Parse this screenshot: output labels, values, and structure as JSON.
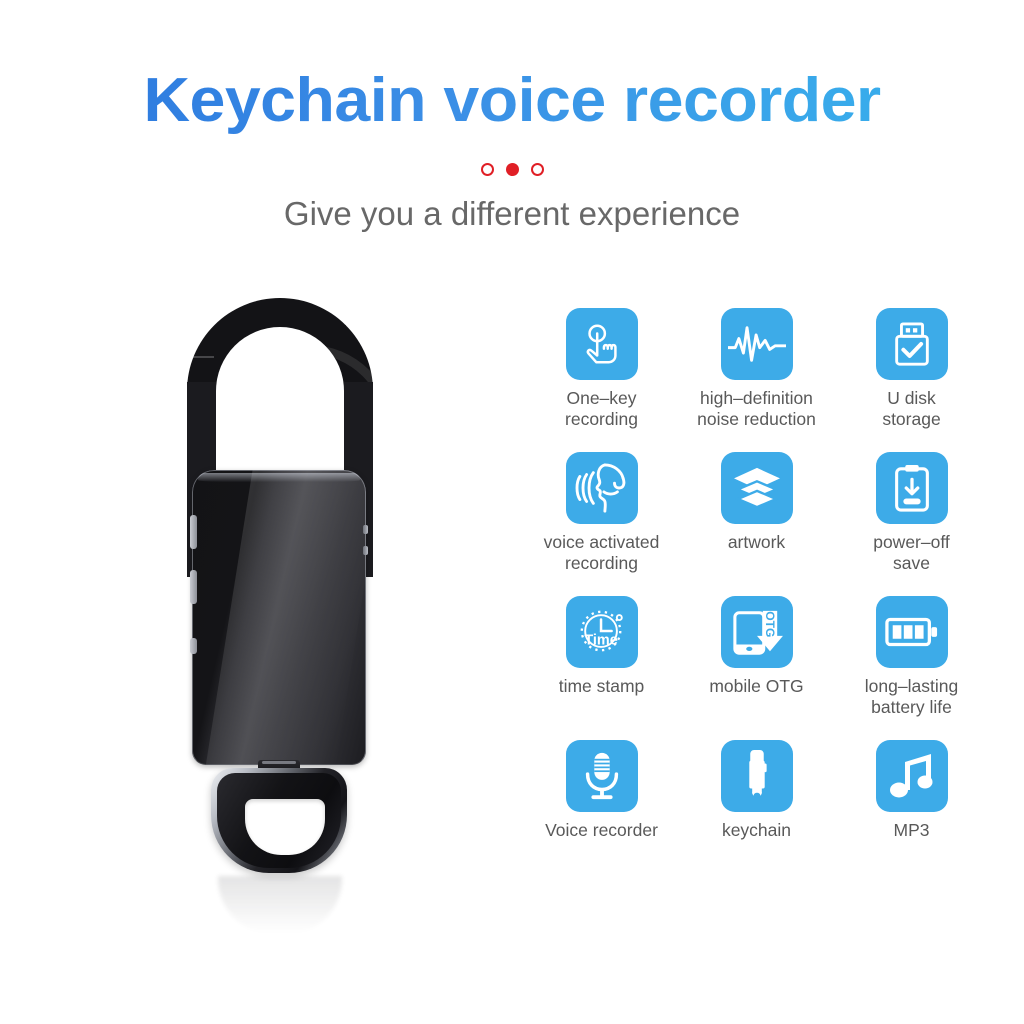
{
  "page": {
    "background_color": "#ffffff",
    "title": "Keychain voice recorder",
    "subtitle": "Give you a different experience",
    "title_gradient_from": "#2f7de0",
    "title_gradient_to": "#36b4ef",
    "subtitle_color": "#686868",
    "accent_tile_color": "#3dabe8",
    "dot_color": "#e01f26",
    "label_color": "#595959"
  },
  "dots": [
    {
      "name": "dot-1",
      "style": "hollow"
    },
    {
      "name": "dot-2",
      "style": "filled"
    },
    {
      "name": "dot-3",
      "style": "hollow"
    }
  ],
  "product": {
    "name": "keychain-voice-recorder",
    "body_color": "#1c1c20",
    "hook_color": "#131316",
    "ring_metal_color": "#c9ccd2"
  },
  "features": [
    [
      {
        "icon": "one-key-tap-icon",
        "label": "One–key\nrecording"
      },
      {
        "icon": "waveform-icon",
        "label": "high–definition\nnoise reduction"
      },
      {
        "icon": "usb-drive-check-icon",
        "label": "U disk\nstorage"
      }
    ],
    [
      {
        "icon": "voice-activated-icon",
        "label": "voice activated\nrecording"
      },
      {
        "icon": "layers-icon",
        "label": "artwork"
      },
      {
        "icon": "power-off-save-icon",
        "label": "power–off\nsave"
      }
    ],
    [
      {
        "icon": "time-stamp-clock-icon",
        "label": "time stamp",
        "icon_text": "Time"
      },
      {
        "icon": "mobile-otg-icon",
        "label": "mobile OTG",
        "icon_text": "OTG"
      },
      {
        "icon": "battery-full-icon",
        "label": "long–lasting\nbattery life"
      }
    ],
    [
      {
        "icon": "microphone-icon",
        "label": "Voice recorder"
      },
      {
        "icon": "keychain-device-icon",
        "label": "keychain"
      },
      {
        "icon": "music-note-icon",
        "label": "MP3"
      }
    ]
  ]
}
